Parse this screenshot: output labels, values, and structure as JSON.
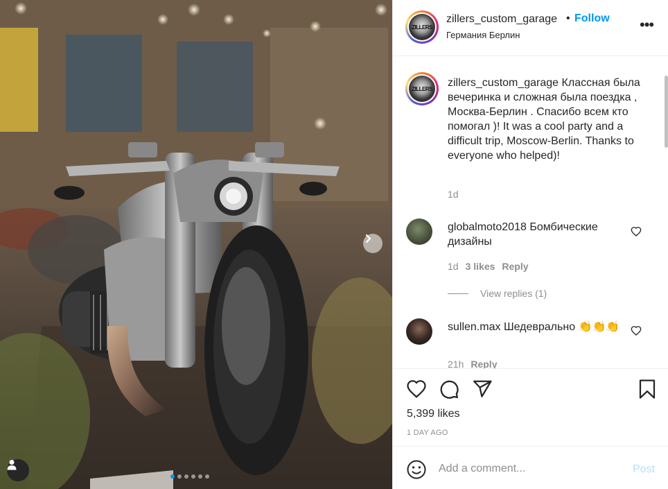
{
  "post": {
    "username": "zillers_custom_garage",
    "follow_label": "Follow",
    "separator": "•",
    "location": "Германия Берлин",
    "more_label": "•••",
    "caption_username": "zillers_custom_garage",
    "caption": "Классная была вечеринка и сложная была поездка , Москва-Берлин . Спасибо всем кто помогал )! It was a cool party and a difficult trip, Moscow-Berlin. Thanks to everyone who helped)!",
    "caption_time": "1d",
    "avatar_text": "ZILLERS",
    "likes": "5,399 likes",
    "timestamp": "1 DAY AGO",
    "carousel": {
      "total": 6,
      "active_index": 0
    }
  },
  "comments": [
    {
      "username": "globalmoto2018",
      "text": "Бомбические дизайны",
      "time": "1d",
      "likes": "3 likes",
      "reply_label": "Reply",
      "view_replies": "View replies (1)"
    },
    {
      "username": "sullen.max",
      "text": "Шедеврально 👏👏👏",
      "time": "21h",
      "reply_label": "Reply"
    }
  ],
  "comment_box": {
    "placeholder": "Add a comment...",
    "post_label": "Post"
  },
  "icons": [
    "next-arrow-icon",
    "user-tag-icon",
    "more-options-icon",
    "heart-icon",
    "comment-icon",
    "share-icon",
    "bookmark-icon",
    "emoji-icon"
  ],
  "colors": {
    "accent": "#0095f6",
    "text": "#262626",
    "muted": "#8e8e8e",
    "post_disabled": "#b2dffc"
  }
}
